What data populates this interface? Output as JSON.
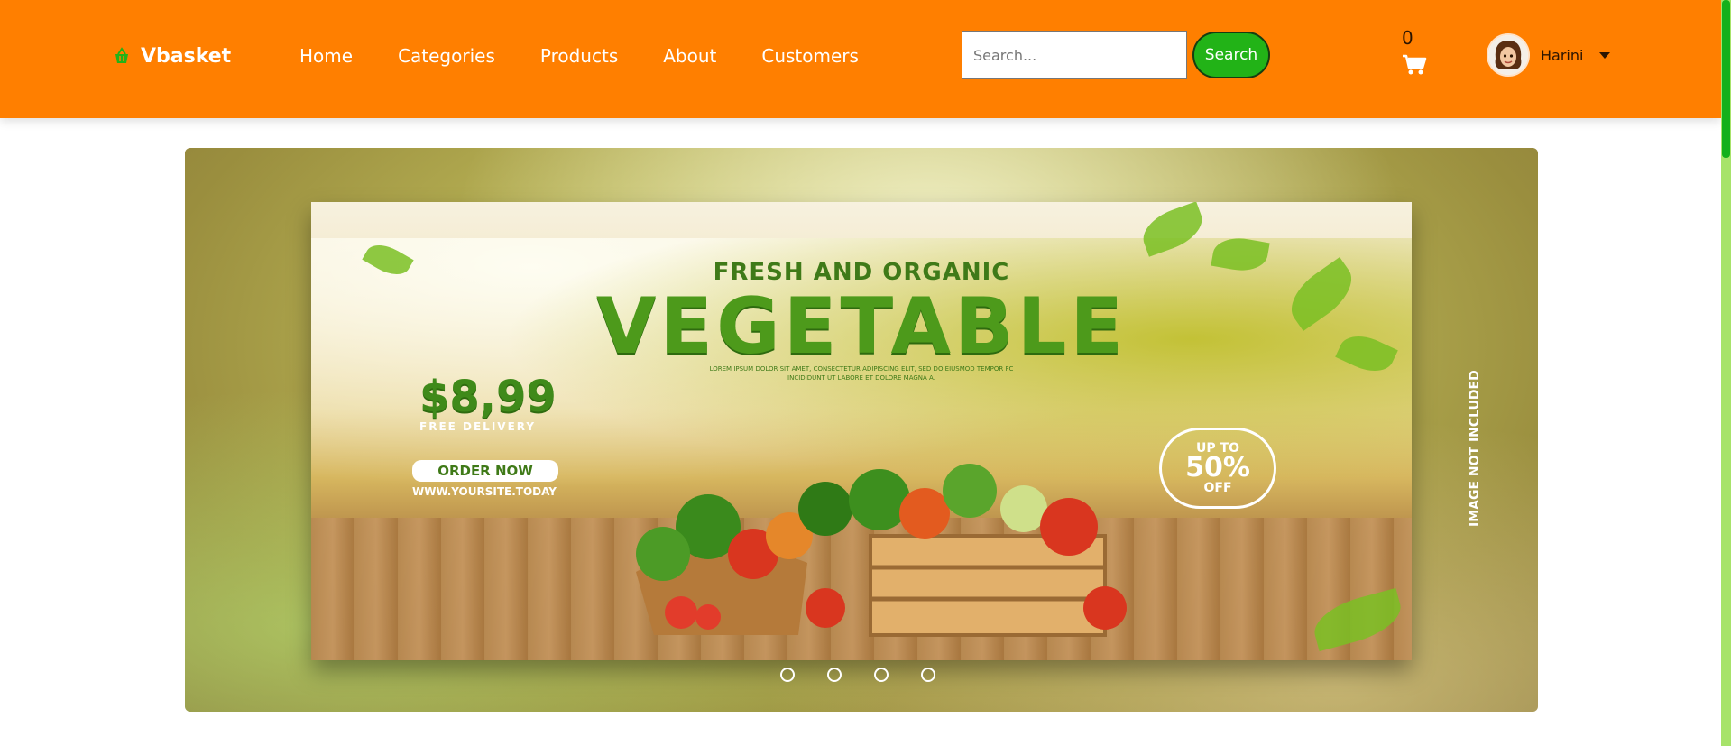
{
  "header": {
    "brand": "Vbasket",
    "nav": [
      "Home",
      "Categories",
      "Products",
      "About",
      "Customers"
    ],
    "search": {
      "placeholder": "Search...",
      "button_label": "Search"
    },
    "cart": {
      "count": "0"
    },
    "user": {
      "name": "Harini"
    }
  },
  "hero": {
    "kicker": "FRESH AND ORGANIC",
    "headline": "VEGETABLE",
    "lorem": "LOREM IPSUM DOLOR SIT AMET, CONSECTETUR ADIPISCING ELIT, SED DO EIUSMOD TEMPOR FC INCIDIDUNT UT LABORE ET DOLORE MAGNA A.",
    "price": "$8,99",
    "delivery": "FREE DELIVERY",
    "order_button": "ORDER NOW",
    "website": "WWW.YOURSITE.TODAY",
    "offer": {
      "line1": "UP TO",
      "line2": "50%",
      "line3": "OFF"
    },
    "side_note": "IMAGE NOT INCLUDED",
    "slide_count": 4
  },
  "colors": {
    "header": "#ff7f00",
    "accent": "#22b317",
    "scrollbar_track": "#a7e36a",
    "scrollbar_thumb": "#13b01b"
  },
  "icons": {
    "brand": "basket-icon",
    "cart": "cart-icon",
    "caret": "chevron-down-icon"
  }
}
